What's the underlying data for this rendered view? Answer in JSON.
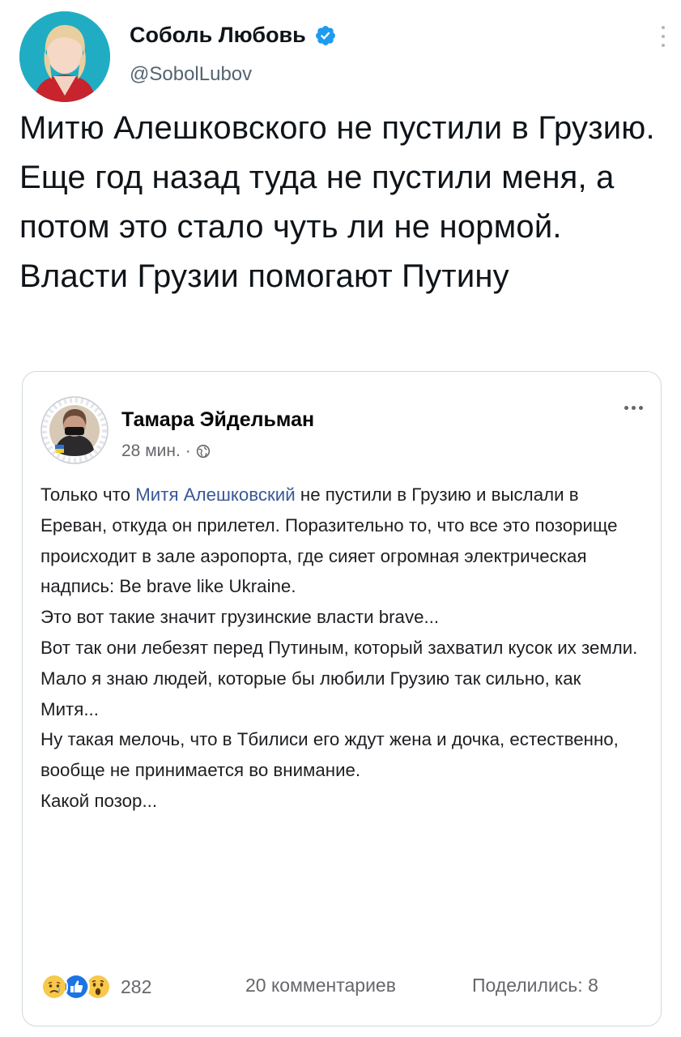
{
  "tweet": {
    "author": {
      "display_name": "Соболь Любовь",
      "handle": "@SobolLubov"
    },
    "text": "Митю Алешковского не пустили в Грузию. Еще год назад туда не пустили меня, а потом это стало чуть ли не нормой. Власти Грузии помогают Путину"
  },
  "quoted_post": {
    "author": "Тамара Эйдельман",
    "time": "28 мин.",
    "text_before_link": "Только что ",
    "link_text": "Митя Алешковский",
    "text_after_link": " не пустили в Грузию и выслали в Ереван, откуда он прилетел. Поразительно то, что все это позорище происходит в зале аэропорта, где сияет огромная электрическая надпись: Be brave like Ukraine.\nЭто вот такие значит грузинские власти brave...\nВот так они лебезят перед Путиным, который захватил кусок их земли.\nМало я знаю людей, которые бы любили Грузию так сильно, как Митя...\nНу такая мелочь, что в Тбилиси его ждут жена и дочка, естественно, вообще не принимается во внимание.\nКакой позор...",
    "reactions": {
      "icons": [
        "sad-icon",
        "like-icon",
        "wow-icon"
      ],
      "count": "282"
    },
    "comments": "20 комментариев",
    "shares": "Поделились: 8"
  }
}
